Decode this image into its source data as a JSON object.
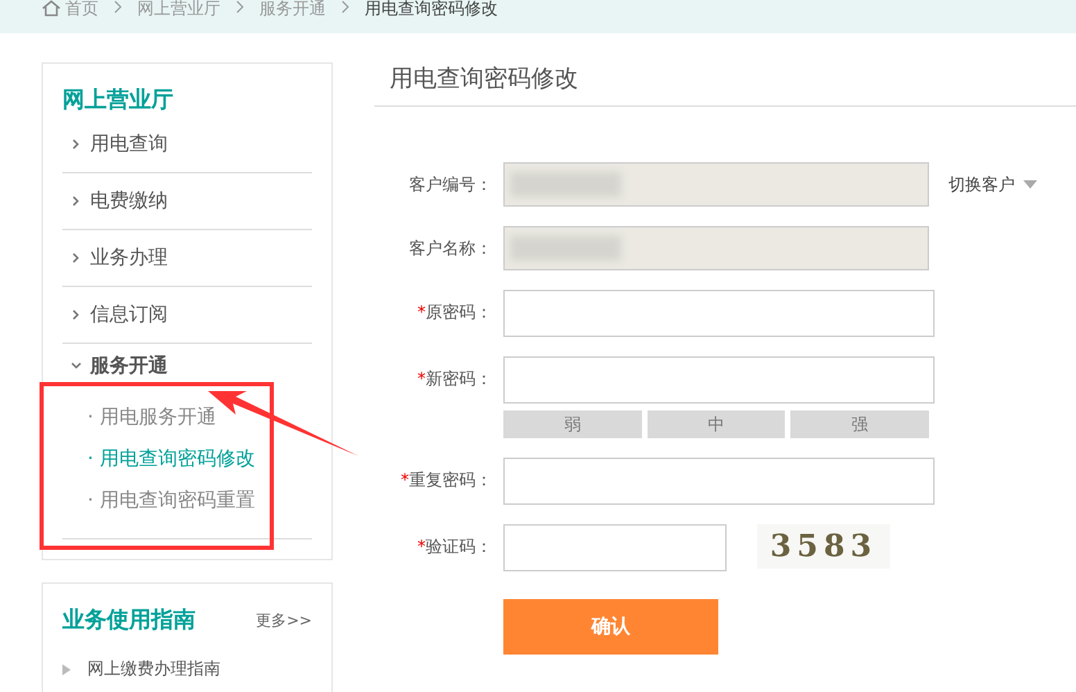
{
  "breadcrumb": [
    {
      "label": "首页",
      "kind": "home",
      "selected": false
    },
    {
      "label": "网上营业厅",
      "selected": false
    },
    {
      "label": "服务开通",
      "selected": false
    },
    {
      "label": "用电查询密码修改",
      "selected": true
    }
  ],
  "sidebar": {
    "title": "网上营业厅",
    "items": [
      {
        "label": "用电查询",
        "expanded": false
      },
      {
        "label": "电费缴纳",
        "expanded": false
      },
      {
        "label": "业务办理",
        "expanded": false
      },
      {
        "label": "信息订阅",
        "expanded": false
      },
      {
        "label": "服务开通",
        "expanded": true,
        "children": [
          {
            "bullet": "·",
            "label": "用电服务开通",
            "selected": false
          },
          {
            "bullet": "·",
            "label": "用电查询密码修改",
            "selected": true
          },
          {
            "bullet": "·",
            "label": "用电查询密码重置",
            "selected": false
          }
        ]
      }
    ]
  },
  "guide": {
    "title": "业务使用指南",
    "more": "更多>>",
    "items": [
      "网上缴费办理指南"
    ]
  },
  "form": {
    "title": "用电查询密码修改",
    "fields": [
      {
        "label": "客户编号：",
        "kind": "readonly",
        "switch_customer": "切换客户"
      },
      {
        "label": "客户名称：",
        "kind": "readonly"
      },
      {
        "label": "原密码：",
        "kind": "password",
        "required_mark": "*"
      },
      {
        "label": "新密码：",
        "kind": "password",
        "required_mark": "*",
        "strength": [
          {
            "label": "弱",
            "on": false
          },
          {
            "label": "中",
            "on": false
          },
          {
            "label": "强",
            "on": false
          }
        ]
      },
      {
        "label": "重复密码：",
        "kind": "password",
        "required_mark": "*"
      },
      {
        "label": "验证码：",
        "kind": "captcha",
        "required_mark": "*",
        "captcha": "3583"
      }
    ],
    "submit": "确认"
  }
}
